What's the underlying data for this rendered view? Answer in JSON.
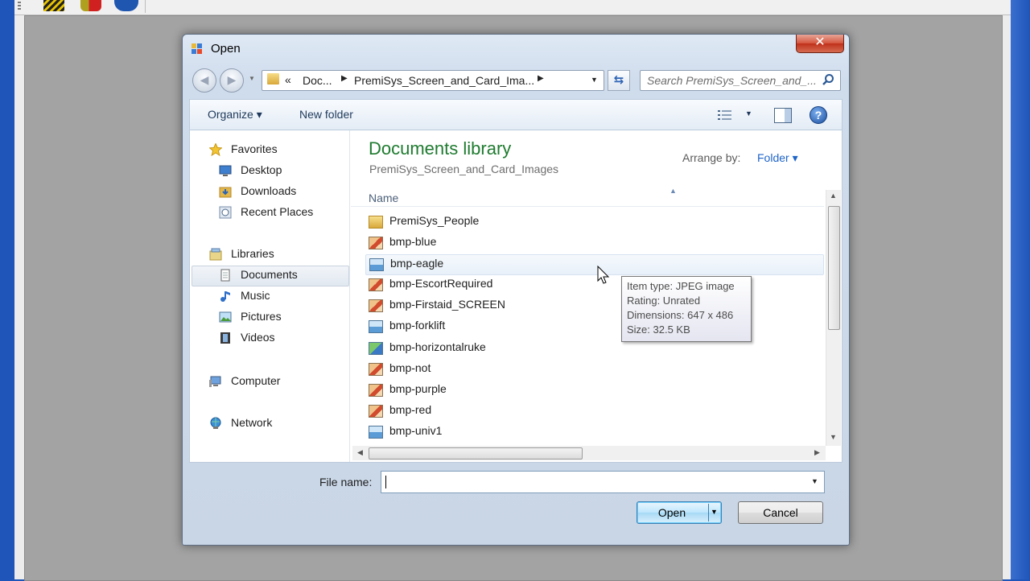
{
  "dialog": {
    "title": "Open",
    "close_glyph": "✕"
  },
  "address": {
    "chevron": "«",
    "segments": [
      "Doc...",
      "PremiSys_Screen_and_Card_Ima..."
    ],
    "search_placeholder": "Search PremiSys_Screen_and_..."
  },
  "commands": {
    "organize": "Organize ▾",
    "new_folder": "New folder",
    "help": "?"
  },
  "nav": {
    "items": [
      {
        "label": "Favorites",
        "icon": "star-icon"
      },
      {
        "label": "Desktop",
        "icon": "desktop-icon"
      },
      {
        "label": "Downloads",
        "icon": "downloads-icon"
      },
      {
        "label": "Recent Places",
        "icon": "recent-places-icon"
      },
      {
        "label": "Libraries",
        "icon": "libraries-icon"
      },
      {
        "label": "Documents",
        "icon": "documents-icon"
      },
      {
        "label": "Music",
        "icon": "music-icon"
      },
      {
        "label": "Pictures",
        "icon": "pictures-icon"
      },
      {
        "label": "Videos",
        "icon": "videos-icon"
      },
      {
        "label": "Computer",
        "icon": "computer-icon"
      },
      {
        "label": "Network",
        "icon": "network-icon"
      }
    ],
    "selected": "Documents"
  },
  "library": {
    "title": "Documents library",
    "subtitle": "PremiSys_Screen_and_Card_Images",
    "arrange_label": "Arrange by:",
    "arrange_value": "Folder ▾",
    "column_name": "Name"
  },
  "files": [
    {
      "name": "PremiSys_People",
      "icon": "folder-icon"
    },
    {
      "name": "bmp-blue",
      "icon": "bitmap-icon"
    },
    {
      "name": "bmp-eagle",
      "icon": "jpeg-icon"
    },
    {
      "name": "bmp-EscortRequired",
      "icon": "bitmap-icon"
    },
    {
      "name": "bmp-Firstaid_SCREEN",
      "icon": "bitmap-icon"
    },
    {
      "name": "bmp-forklift",
      "icon": "jpeg-icon"
    },
    {
      "name": "bmp-horizontalruke",
      "icon": "image-icon"
    },
    {
      "name": "bmp-not",
      "icon": "bitmap-icon"
    },
    {
      "name": "bmp-purple",
      "icon": "bitmap-icon"
    },
    {
      "name": "bmp-red",
      "icon": "bitmap-icon"
    },
    {
      "name": "bmp-univ1",
      "icon": "jpeg-icon"
    }
  ],
  "tooltip": {
    "lines": [
      "Item type: JPEG image",
      "Rating: Unrated",
      "Dimensions: 647 x 486",
      "Size: 32.5 KB"
    ]
  },
  "footer": {
    "file_name_label": "File name:",
    "file_name_value": "",
    "open_label": "Open",
    "cancel_label": "Cancel"
  },
  "colors": {
    "library_title": "#1e7b2f",
    "link_blue": "#1e64c8",
    "desktop_bg": "#1f55b8"
  }
}
